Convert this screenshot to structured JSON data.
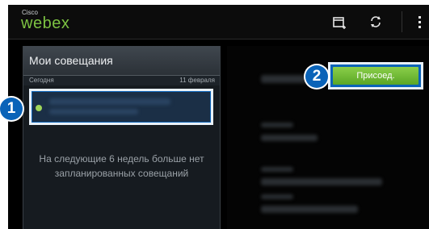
{
  "app": {
    "logo_brand": "Cisco",
    "logo_name": "webex"
  },
  "toolbar": {
    "icons": [
      "add-calendar-icon",
      "sync-icon",
      "overflow-menu-icon"
    ]
  },
  "left_panel": {
    "title": "Мои совещания",
    "section_label": "Сегодня",
    "section_date": "11 февраля",
    "empty_message_line1": "На следующие 6 недель больше нет",
    "empty_message_line2": "запланированных совещаний"
  },
  "right_panel": {
    "join_button_label": "Присоед."
  },
  "callouts": {
    "one": "1",
    "two": "2"
  },
  "colors": {
    "brand_green": "#7cc242",
    "join_green": "#6bb832",
    "callout_blue": "#0a63b8",
    "status_dot": "#9fd65a"
  }
}
